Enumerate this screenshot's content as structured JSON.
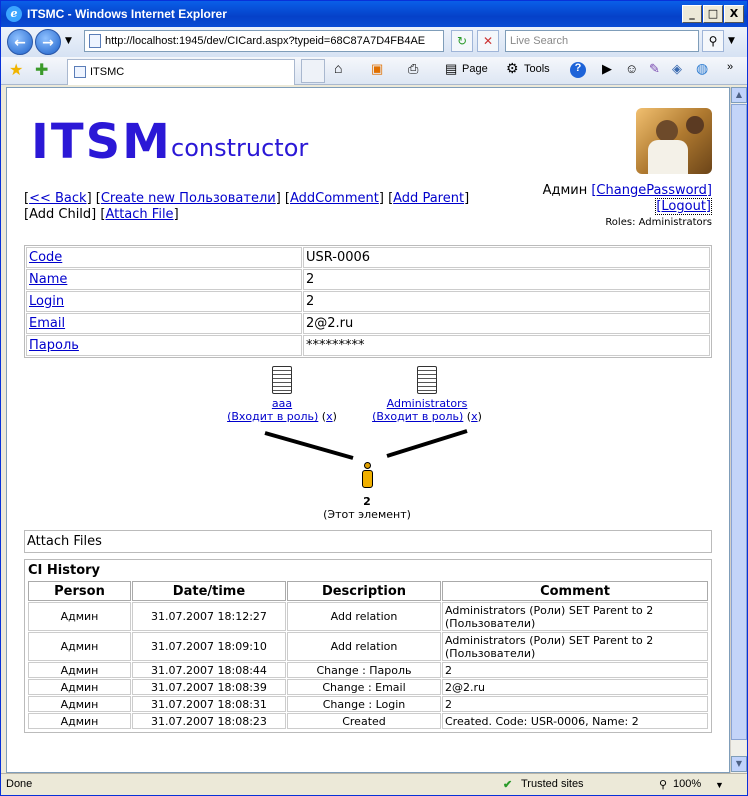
{
  "window": {
    "title": "ITSMC - Windows Internet Explorer",
    "min": "_",
    "max": "□",
    "close": "X"
  },
  "nav": {
    "url": "http://localhost:1945/dev/CICard.aspx?typeid=68C87A7D4FB4AE",
    "search_placeholder": "Live Search"
  },
  "tabbar": {
    "tab_label": "ITSMC",
    "page": "Page",
    "tools": "Tools"
  },
  "page": {
    "logo_big": "ITSM",
    "logo_small": "constructor",
    "links": {
      "back": "<< Back",
      "create": "Create new Пользователи",
      "addcomment": "AddComment",
      "addparent": "Add Parent",
      "addchild": "Add Child",
      "attach": "Attach File"
    },
    "user": {
      "name": "Админ",
      "change_password": "[ChangePassword]",
      "logout": "[Logout]",
      "roles": "Roles: Administrators"
    },
    "attrs": [
      {
        "key": "Code",
        "value": "USR-0006"
      },
      {
        "key": "Name",
        "value": "2"
      },
      {
        "key": "Login",
        "value": "2"
      },
      {
        "key": "Email",
        "value": "2@2.ru"
      },
      {
        "key": "Пароль",
        "value": "*********"
      }
    ],
    "graph": {
      "parents": [
        {
          "name": "aaa",
          "relation": "(Входит в роль)",
          "remove": "x"
        },
        {
          "name": "Administrators",
          "relation": "(Входит в роль)",
          "remove": "x"
        }
      ],
      "self_name": "2",
      "self_label": "(Этот элемент)"
    },
    "attach_title": "Attach Files",
    "history": {
      "title": "CI History",
      "headers": [
        "Person",
        "Date/time",
        "Description",
        "Comment"
      ],
      "rows": [
        [
          "Админ",
          "31.07.2007 18:12:27",
          "Add relation",
          "Administrators (Роли) SET Parent to 2 (Пользователи)"
        ],
        [
          "Админ",
          "31.07.2007 18:09:10",
          "Add relation",
          "Administrators (Роли) SET Parent to 2 (Пользователи)"
        ],
        [
          "Админ",
          "31.07.2007 18:08:44",
          "Change : Пароль",
          "2"
        ],
        [
          "Админ",
          "31.07.2007 18:08:39",
          "Change : Email",
          "2@2.ru"
        ],
        [
          "Админ",
          "31.07.2007 18:08:31",
          "Change : Login",
          "2"
        ],
        [
          "Админ",
          "31.07.2007 18:08:23",
          "Created",
          "Created. Code: USR-0006, Name: 2"
        ]
      ]
    }
  },
  "status": {
    "left": "Done",
    "zone": "Trusted sites",
    "zoom": "100%"
  }
}
